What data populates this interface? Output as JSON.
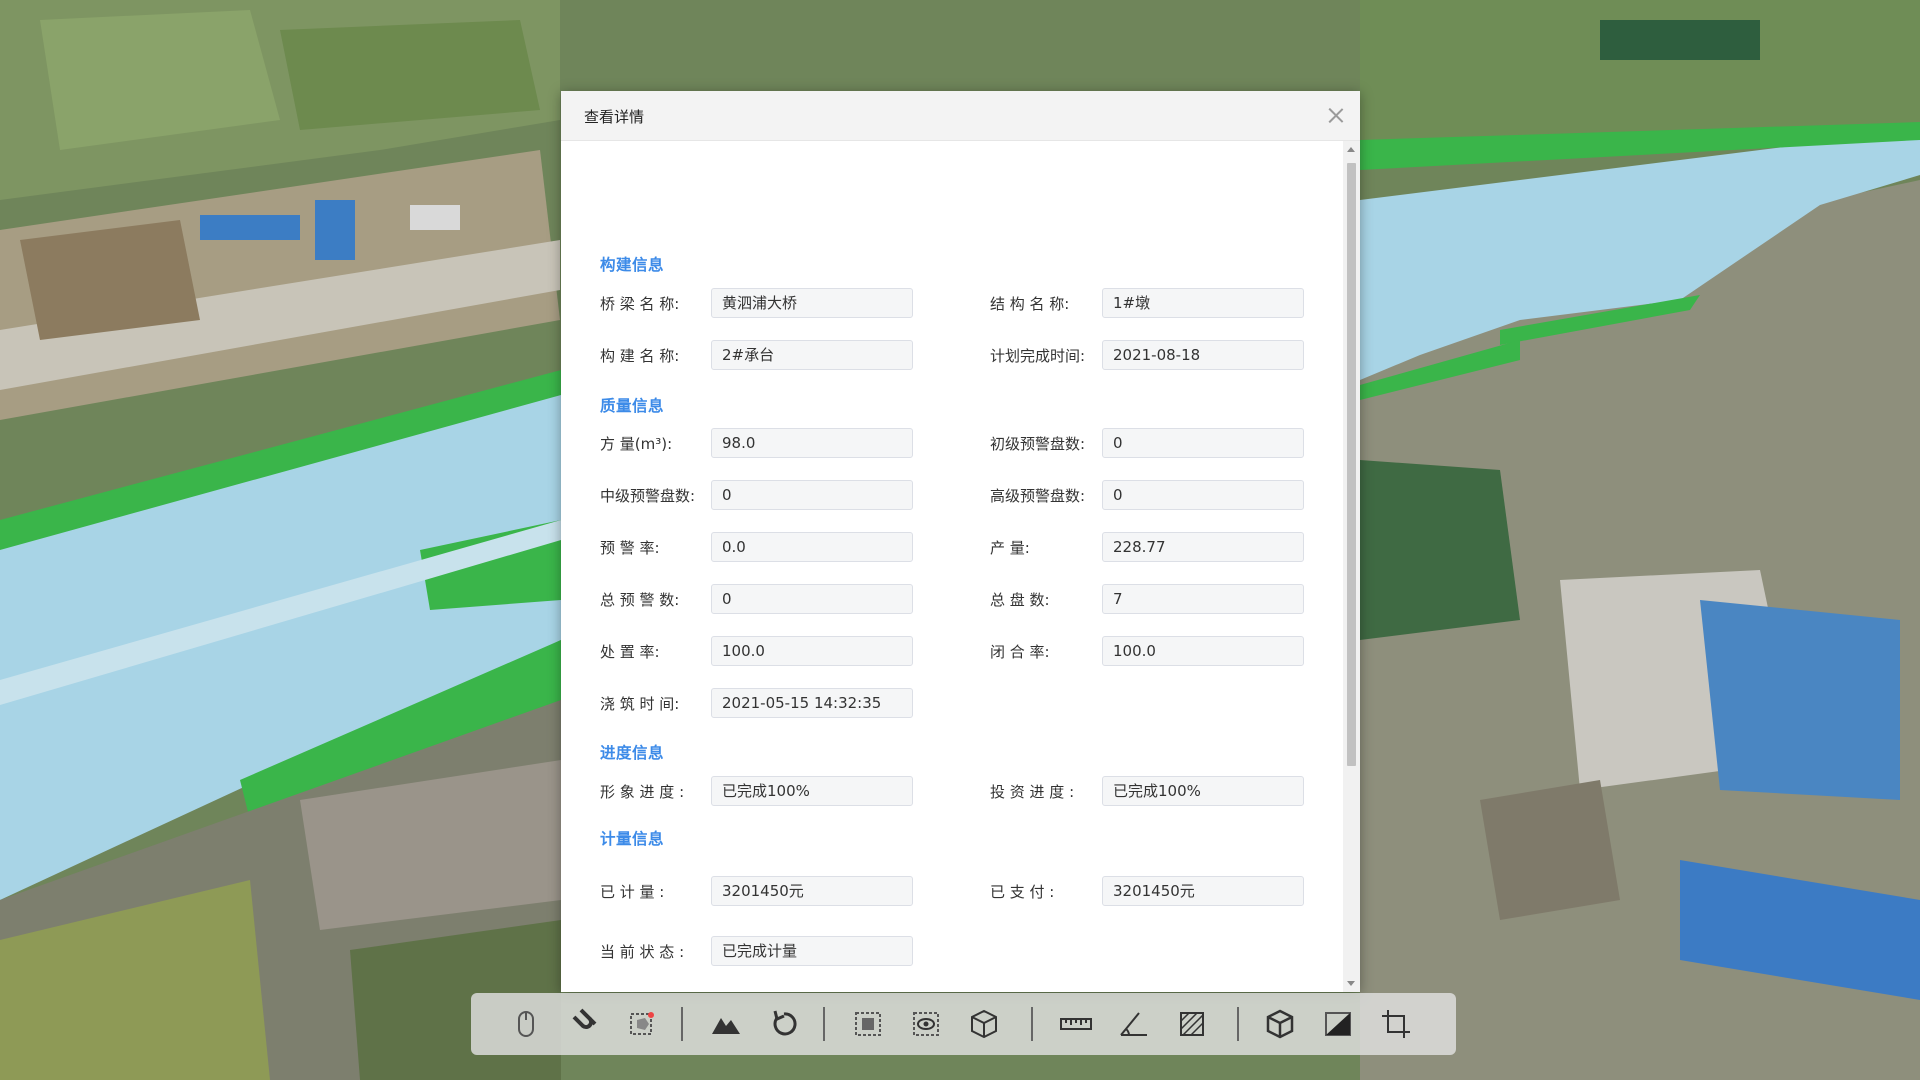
{
  "dialog": {
    "title": "查看详情",
    "sections": {
      "component": "构建信息",
      "quality": "质量信息",
      "progress": "进度信息",
      "metering": "计量信息"
    },
    "fields": {
      "bridge_name": {
        "label": "桥 梁 名 称:",
        "value": "黄泗浦大桥"
      },
      "structure_name": {
        "label": "结 构 名 称:",
        "value": "1#墩"
      },
      "component_name": {
        "label": "构 建 名 称:",
        "value": "2#承台"
      },
      "plan_finish_time": {
        "label": "计划完成时间:",
        "value": "2021-08-18"
      },
      "volume": {
        "label": "方      量(m³):",
        "value": "98.0"
      },
      "primary_warning": {
        "label": "初级预警盘数:",
        "value": "0"
      },
      "mid_warning": {
        "label": "中级预警盘数:",
        "value": "0"
      },
      "high_warning": {
        "label": "高级预警盘数:",
        "value": "0"
      },
      "warning_rate": {
        "label": "预    警    率:",
        "value": "0.0"
      },
      "output": {
        "label": "产            量:",
        "value": "228.77"
      },
      "total_warning": {
        "label": "总 预 警 数:",
        "value": "0"
      },
      "total_batches": {
        "label": "总     盘     数:",
        "value": "7"
      },
      "disposal_rate": {
        "label": "处    置    率:",
        "value": "100.0"
      },
      "closure_rate": {
        "label": "闭     合     率:",
        "value": "100.0"
      },
      "pour_time": {
        "label": "浇 筑 时 间:",
        "value": "2021-05-15 14:32:35"
      },
      "image_progress": {
        "label": "形 象 进 度 :",
        "value": "已完成100%"
      },
      "invest_progress": {
        "label": "投 资 进 度 :",
        "value": "已完成100%"
      },
      "metered": {
        "label": "已 计 量 :",
        "value": "3201450元"
      },
      "paid": {
        "label": "已 支 付 :",
        "value": "3201450元"
      },
      "current_status": {
        "label": "当 前 状 态 :",
        "value": "已完成计量"
      }
    }
  },
  "toolbar": {
    "tools": [
      "mouse-icon",
      "magnet-icon",
      "select-box-icon",
      "terrain-icon",
      "rotate-icon",
      "area-select-icon",
      "visibility-icon",
      "cube-icon",
      "ruler-icon",
      "angle-icon",
      "area-measure-icon",
      "model-icon",
      "slope-icon",
      "crop-icon"
    ]
  },
  "colors": {
    "section_title": "#3d8be8",
    "canal": "#a8d4e6",
    "embankment": "#3ab54a"
  }
}
